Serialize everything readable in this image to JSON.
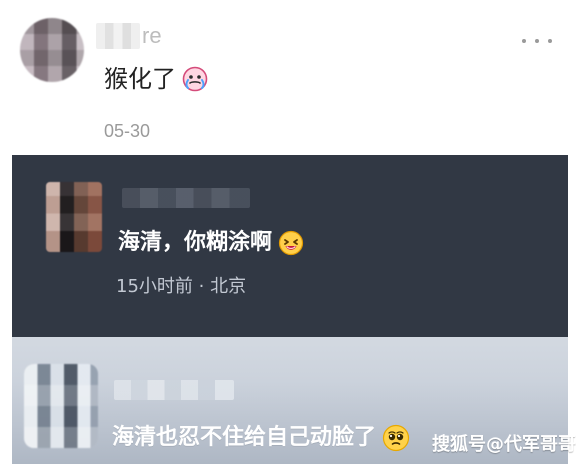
{
  "top": {
    "comment_text": "猴化了",
    "date": "05-30",
    "name_suffix": "re",
    "emoji": "crying-face-icon"
  },
  "mid": {
    "comment_text": "海清，你糊涂啊",
    "meta": "15小时前 · 北京",
    "emoji": "grinning-squint-face-icon"
  },
  "bottom": {
    "comment_text": "海清也忍不住给自己动脸了",
    "emoji": "pleading-face-icon"
  },
  "watermark": {
    "text": "搜狐号@代军哥哥"
  },
  "colors": {
    "dark_card_bg": "#313844",
    "bottom_card_top": "#d3d9e1",
    "bottom_card_bottom": "#aeb7c4",
    "text_primary": "#222222",
    "text_muted": "#9a9a9a",
    "text_on_dark": "#ffffff",
    "meta_on_dark": "#c2c8d2"
  }
}
